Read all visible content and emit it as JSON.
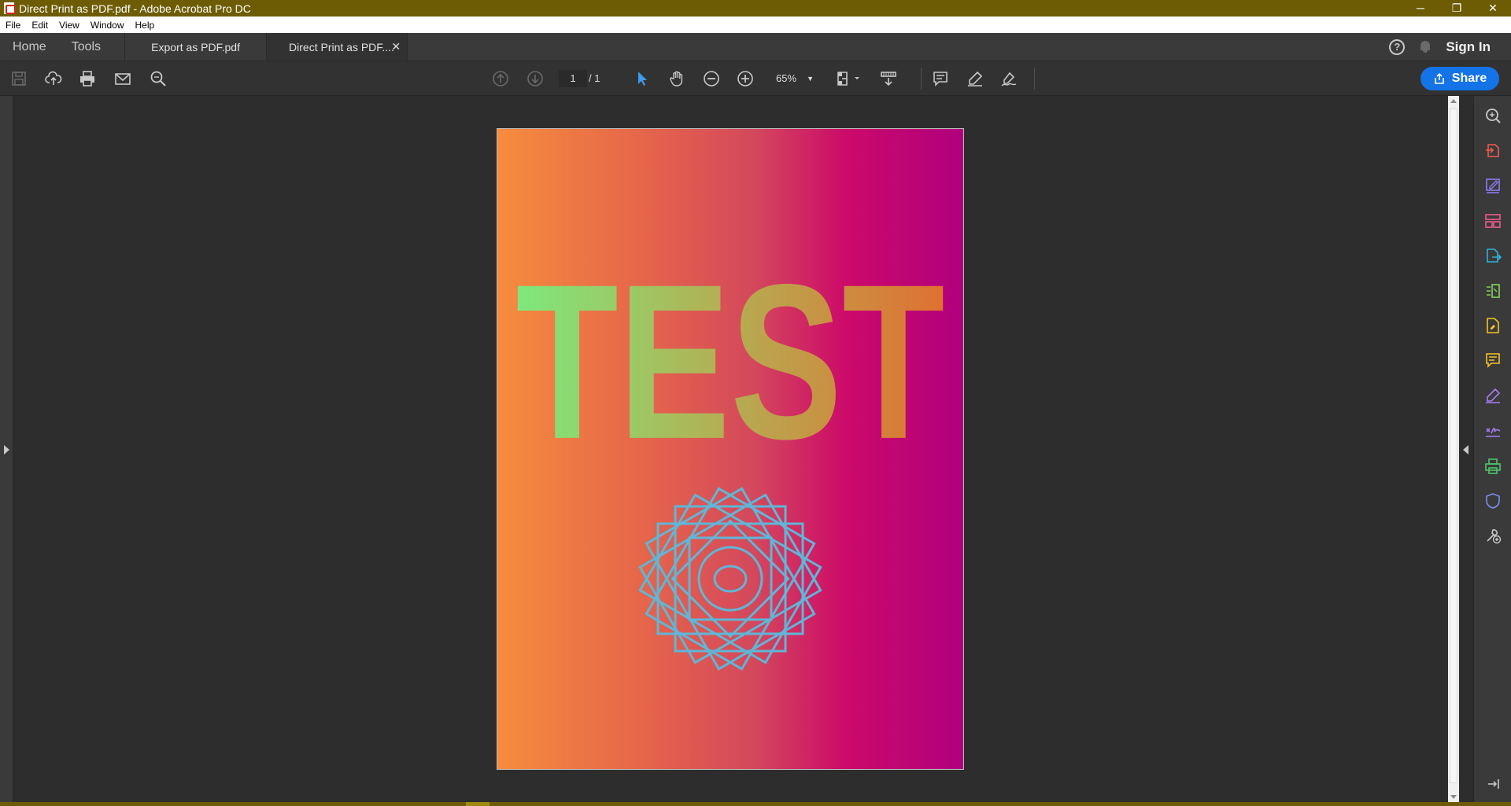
{
  "window": {
    "title": "Direct Print as PDF.pdf - Adobe Acrobat Pro DC",
    "controls": [
      "─",
      "❐",
      "✕"
    ]
  },
  "menu": [
    "File",
    "Edit",
    "View",
    "Window",
    "Help"
  ],
  "tabs": {
    "home": "Home",
    "tools": "Tools",
    "documents": [
      {
        "label": "Export as PDF.pdf",
        "active": false
      },
      {
        "label": "Direct Print as PDF....",
        "active": true,
        "close": "✕"
      }
    ]
  },
  "header_right": {
    "help_glyph": "?",
    "sign_in": "Sign In"
  },
  "toolbar": {
    "page_current": "1",
    "page_total": "/ 1",
    "zoom": "65%",
    "zoom_dropdown": "▼",
    "share_label": "Share"
  },
  "document": {
    "heading": "TEST",
    "accent_color": "#5fb6d6",
    "gradient_colors": [
      "#f68c3d",
      "#cc0a6a",
      "#b0007e"
    ]
  },
  "icons": {
    "toolbar_left": [
      "save-icon",
      "cloud-upload-icon",
      "print-icon",
      "email-icon",
      "search-icon"
    ],
    "toolbar_center": [
      "page-up-icon",
      "page-down-icon",
      "select-cursor-icon",
      "hand-icon",
      "zoom-out-icon",
      "zoom-in-icon",
      "fit-page-icon",
      "scroll-mode-icon",
      "comment-icon",
      "highlight-icon",
      "sign-icon"
    ],
    "tool_pane": [
      "enhance-scan-icon",
      "export-pdf-icon",
      "edit-pdf-icon",
      "organize-pages-icon",
      "export-icon",
      "compress-icon",
      "fill-sign-icon",
      "comment-tool-icon",
      "pen-icon",
      "signature-icon",
      "print-production-icon",
      "protect-icon",
      "more-tools-icon",
      "collapse-pane-icon"
    ]
  }
}
